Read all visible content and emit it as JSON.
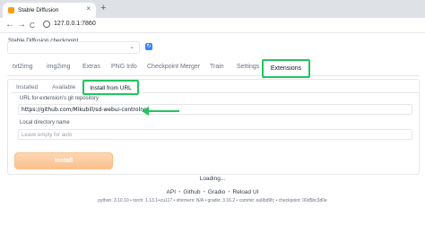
{
  "browser": {
    "tab_title": "Stable Diffusion",
    "tab_close": "×",
    "new_tab": "+",
    "back": "←",
    "forward": "→",
    "reload": "C",
    "url": "127.0.0.1:7860"
  },
  "checkpoint": {
    "label": "Stable Diffusion checkpoint",
    "value": "",
    "chevron": "⌄",
    "refresh_icon": "refresh-icon"
  },
  "main_tabs": [
    "txt2img",
    "img2img",
    "Extras",
    "PNG Info",
    "Checkpoint Merger",
    "Train",
    "Settings",
    "Extensions"
  ],
  "active_main_tab": "Extensions",
  "sub_tabs": [
    "Installed",
    "Available",
    "Install from URL"
  ],
  "active_sub_tab": "Install from URL",
  "install_form": {
    "url_label": "URL for extension's git repository",
    "url_value": "https://github.com/Mikubill/sd-webui-controlnet",
    "dir_label": "Local directory name",
    "dir_placeholder": "Leave empty for auto",
    "install_button": "Install"
  },
  "status": "Loading...",
  "footer": {
    "links": [
      "API",
      "Github",
      "Gradio",
      "Reload UI"
    ],
    "versions": "python: 3.10.10  •  torch: 1.13.1+cu117  •  xformers: N/A  •  gradio: 3.16.2  •  commit: ea9bd9fc  •  checkpoint: 00d5bc3d0e"
  },
  "colors": {
    "highlight": "#22c55e",
    "install_button": "#fbc08f",
    "accent": "#3b82f6"
  }
}
